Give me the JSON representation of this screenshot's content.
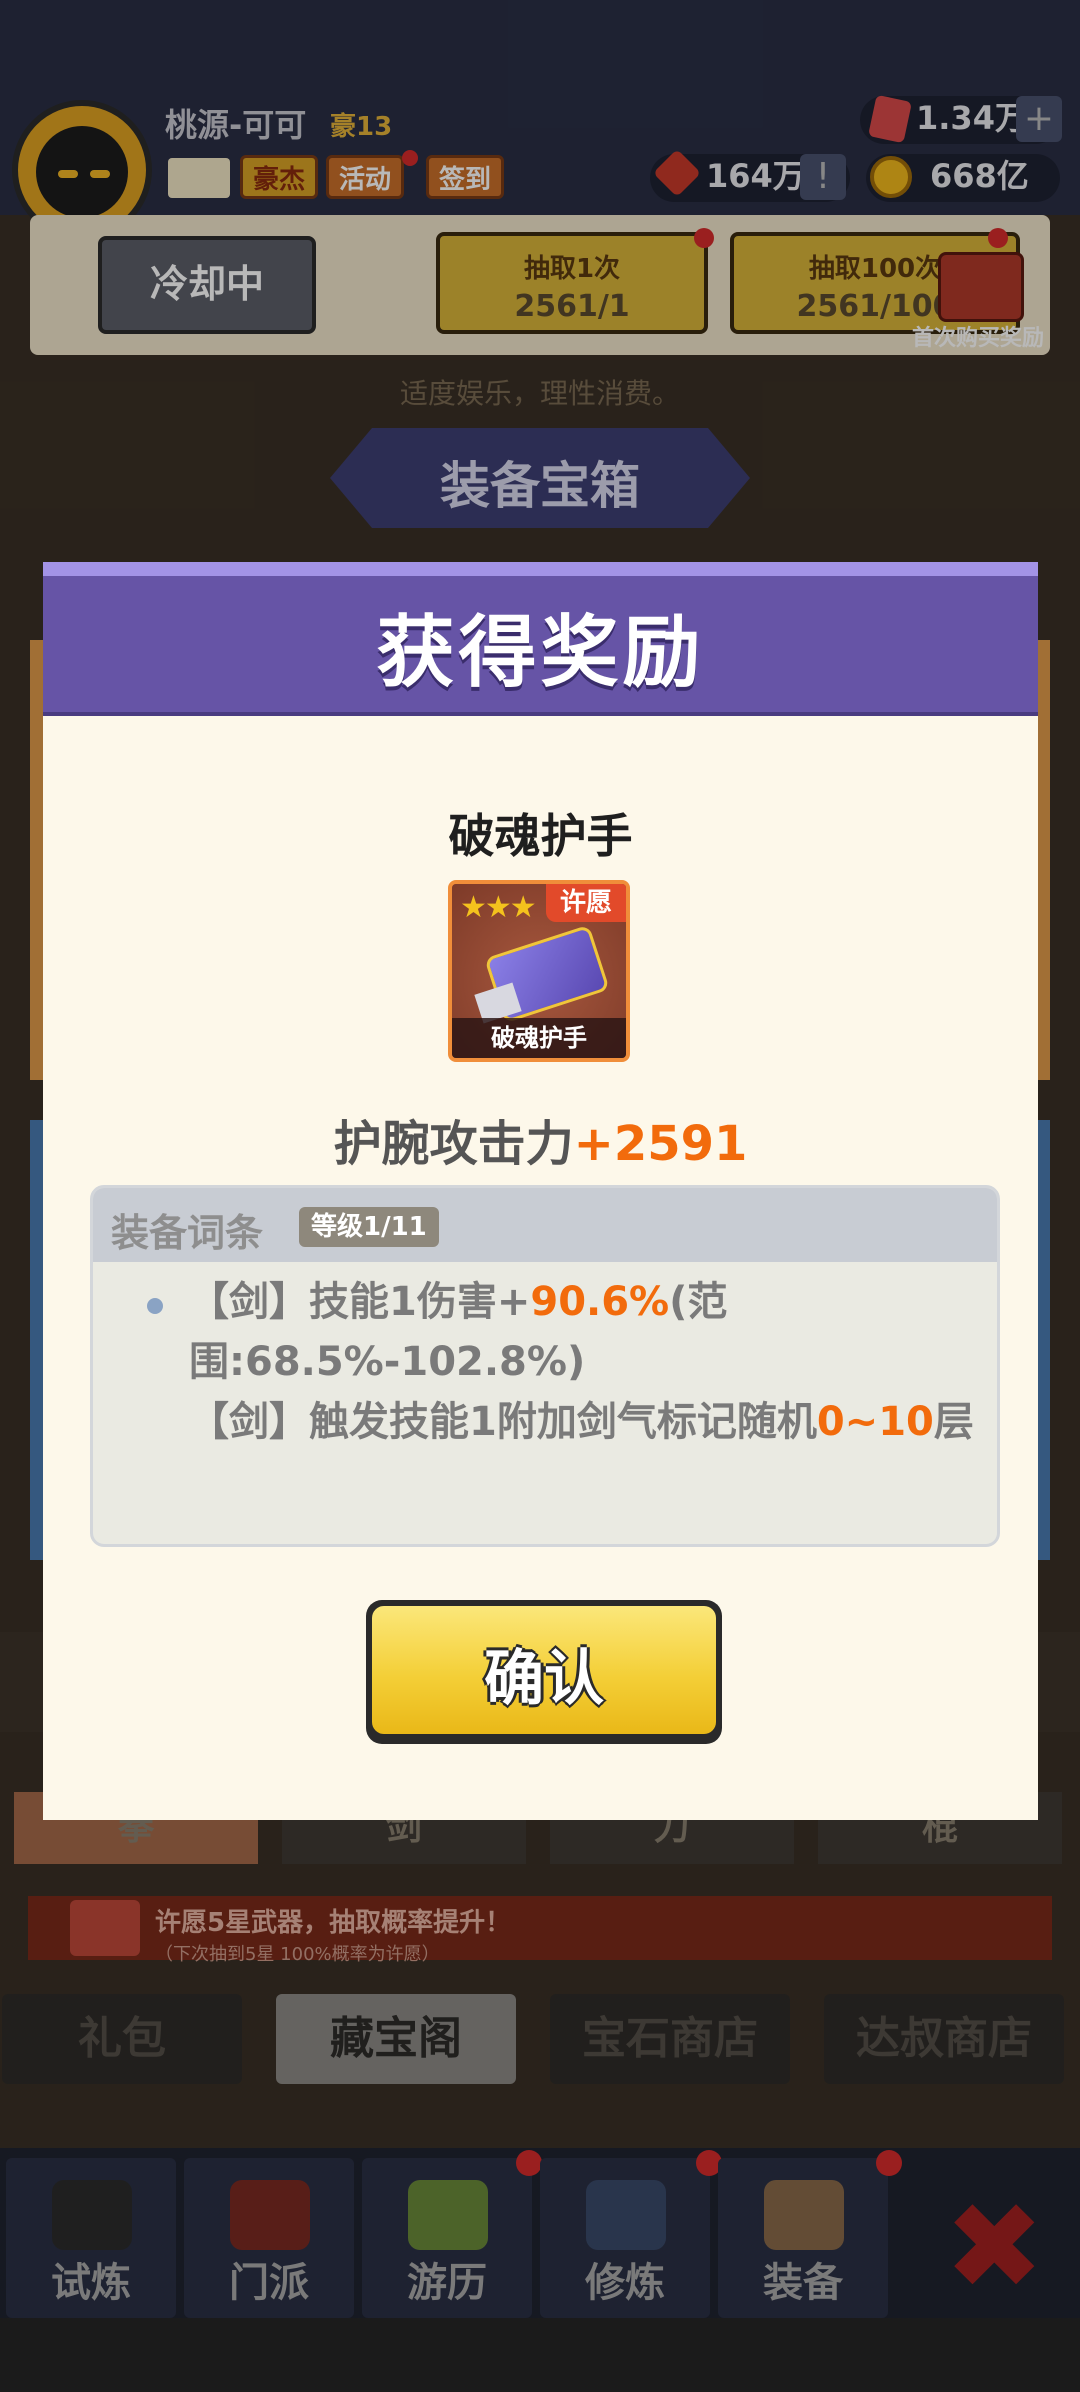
{
  "header": {
    "username": "桃源-可可",
    "rank": "豪13",
    "buttons": [
      "豪杰",
      "活动",
      "签到"
    ],
    "gems": "1.34万",
    "tickets": "164万",
    "coins": "668亿"
  },
  "draw_panel": {
    "cooldown_label": "冷却中",
    "draw1_title": "抽取1次",
    "draw1_cost": "2561/1",
    "draw100_title": "抽取100次",
    "draw100_cost": "2561/100",
    "first_buy_label": "首次购买奖励"
  },
  "tip": "适度娱乐，理性消费。",
  "section_title": "装备宝箱",
  "weapon_tabs": [
    "拳",
    "剑",
    "刀",
    "棍"
  ],
  "wish_bar": {
    "text": "许愿5星武器，抽取概率提升！",
    "subtext": "（下次抽到5星 100%概率为许愿）"
  },
  "shop_tabs": [
    "礼包",
    "藏宝阁",
    "宝石商店",
    "达叔商店"
  ],
  "nav": [
    "试炼",
    "门派",
    "游历",
    "修炼",
    "装备"
  ],
  "modal": {
    "title": "获得奖励",
    "item_name": "破魂护手",
    "item_stars": "★★★",
    "item_tag": "许愿",
    "item_caption": "破魂护手",
    "stat_label": "护腕攻击力",
    "stat_value": "+2591",
    "affix_title": "装备词条",
    "affix_level": "等级1/11",
    "affix_line1_a": "【剑】技能1伤害+",
    "affix_line1_b": "90.6%",
    "affix_line1_c": "(范围:68.5%-102.8%)",
    "affix_line2_a": "【剑】触发技能1附加剑气标记随机",
    "affix_line2_b": "0~10",
    "affix_line2_c": "层",
    "confirm_label": "确认"
  },
  "colors": {
    "modal_header": "#6654a6",
    "accent_orange": "#f26b0c",
    "confirm_yellow": "#f4cf37"
  }
}
